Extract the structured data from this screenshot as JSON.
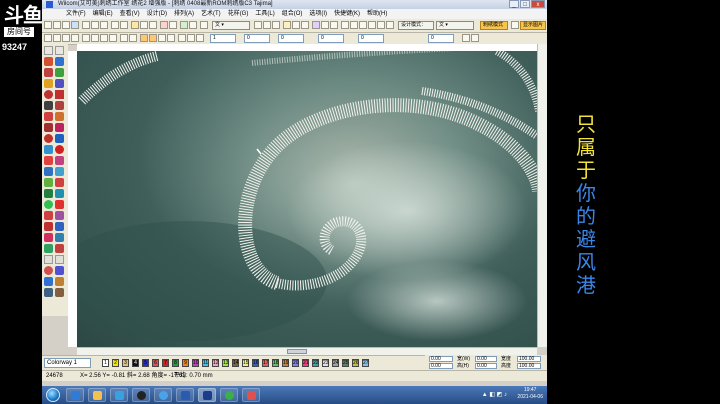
{
  "stream": {
    "logo_text": "斗鱼",
    "logo_sub": "房间号",
    "room_id": "93247"
  },
  "window": {
    "title": "Wilcom(艾可美)刺绣工作室 绣花2 增强版 - [刺绣 0408最新ROM刺绣版C3        Tajima]",
    "controls": [
      "_",
      "□",
      "x"
    ]
  },
  "menu": [
    "文件(F)",
    "编辑(E)",
    "查看(V)",
    "设计(D)",
    "排列(A)",
    "艺术(T)",
    "花样(G)",
    "工具(L)",
    "组合(O)",
    "选项(I)",
    "快捷键(K)",
    "帮助(H)"
  ],
  "toolbar": {
    "font_combo": "文",
    "design_mode": "设计模式：",
    "mode_value": "文",
    "switch_button": "刺绣模式",
    "show_button": "显示图片",
    "num_fields": [
      "1",
      "0",
      "0",
      "0",
      "0",
      "0"
    ]
  },
  "colorbar": {
    "colorway": "Colorway 1",
    "swatches": [
      {
        "label": "1",
        "color": "#ffffff"
      },
      {
        "label": "2",
        "color": "#f2e600"
      },
      {
        "label": "3",
        "color": "#e0c080"
      },
      {
        "label": "4",
        "color": "#111111"
      },
      {
        "label": "5",
        "color": "#2a2ad0"
      },
      {
        "label": "6",
        "color": "#e05050"
      },
      {
        "label": "7",
        "color": "#d02020"
      },
      {
        "label": "8",
        "color": "#20a040"
      },
      {
        "label": "9",
        "color": "#f08020"
      },
      {
        "label": "10",
        "color": "#c040c0"
      },
      {
        "label": "11",
        "color": "#40c0f0"
      },
      {
        "label": "12",
        "color": "#f0a0c0"
      },
      {
        "label": "13",
        "color": "#a0e040"
      },
      {
        "label": "14",
        "color": "#806040"
      },
      {
        "label": "15",
        "color": "#f0f080"
      },
      {
        "label": "16",
        "color": "#3060c0"
      },
      {
        "label": "17",
        "color": "#e06060"
      },
      {
        "label": "18",
        "color": "#60c060"
      },
      {
        "label": "19",
        "color": "#c08040"
      },
      {
        "label": "20",
        "color": "#8080f0"
      },
      {
        "label": "21",
        "color": "#f04080"
      },
      {
        "label": "22",
        "color": "#40a0a0"
      },
      {
        "label": "23",
        "color": "#e0e0e0"
      },
      {
        "label": "24",
        "color": "#a0a0a0"
      },
      {
        "label": "25",
        "color": "#608060"
      },
      {
        "label": "26",
        "color": "#c0c040"
      },
      {
        "label": "27",
        "color": "#80c0e0"
      }
    ]
  },
  "coords": {
    "row1": {
      "label_a": "0.00",
      "label_b": "宽(W)",
      "value_b": "0.00",
      "label_c": "宽度",
      "value_c": "100.00"
    },
    "row2": {
      "label_a": "0.00",
      "label_b": "高(H)",
      "value_b": "0.00",
      "label_c": "高度",
      "value_c": "100.00"
    }
  },
  "status": {
    "stitch_count": "24678",
    "position": "X= 2.56 Y= -0.81 斜= 2.68 角度= -17.61",
    "spacing": "平均: 0.70 mm"
  },
  "taskbar": {
    "clock_time": "19:47",
    "clock_date": "2021-04-06"
  },
  "overlay": {
    "chars": [
      {
        "char": "只",
        "color": "#f3e23a"
      },
      {
        "char": "属",
        "color": "#f3e23a"
      },
      {
        "char": "于",
        "color": "#f3e23a"
      },
      {
        "char": "你",
        "color": "#3a86e8"
      },
      {
        "char": "的",
        "color": "#3a86e8"
      },
      {
        "char": "避",
        "color": "#3a86e8"
      },
      {
        "char": "风",
        "color": "#3a86e8"
      },
      {
        "char": "港",
        "color": "#3a86e8"
      }
    ]
  }
}
